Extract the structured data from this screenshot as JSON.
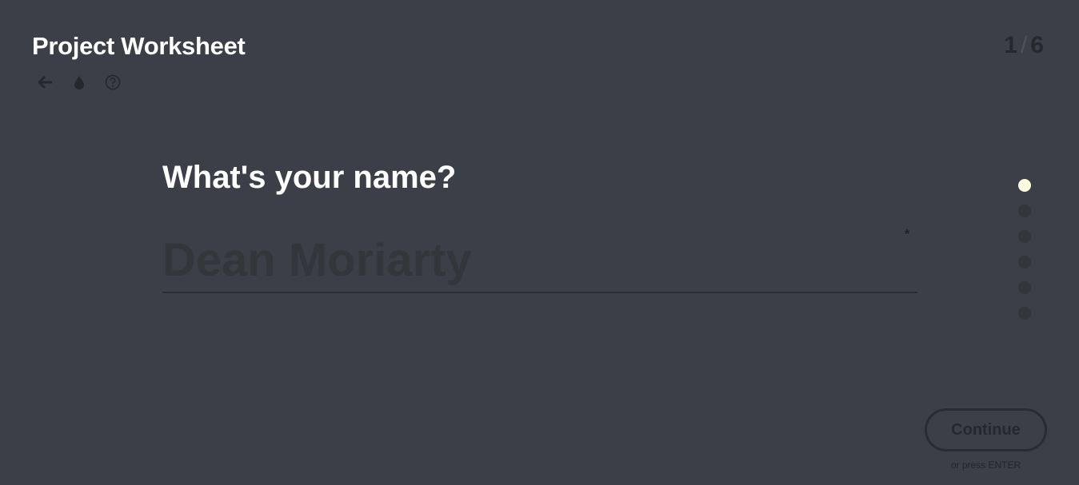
{
  "header": {
    "title": "Project Worksheet",
    "toolbar": {
      "icons": [
        "arrow-left-icon",
        "droplet-icon",
        "help-circle-icon"
      ]
    },
    "counter": {
      "current": "1",
      "separator": "/",
      "total": "6"
    }
  },
  "form": {
    "question": "What's your name?",
    "name_input": {
      "value": "",
      "placeholder": "Dean Moriarty"
    },
    "required_mark": "*"
  },
  "progress": {
    "total_steps": 6,
    "current_step": 1
  },
  "actions": {
    "continue_label": "Continue",
    "hint": "or press ENTER"
  },
  "colors": {
    "background": "#3c3f47",
    "active_dot": "#fffde0",
    "inactive_dot": "#34363c",
    "text": "#ffffff"
  }
}
